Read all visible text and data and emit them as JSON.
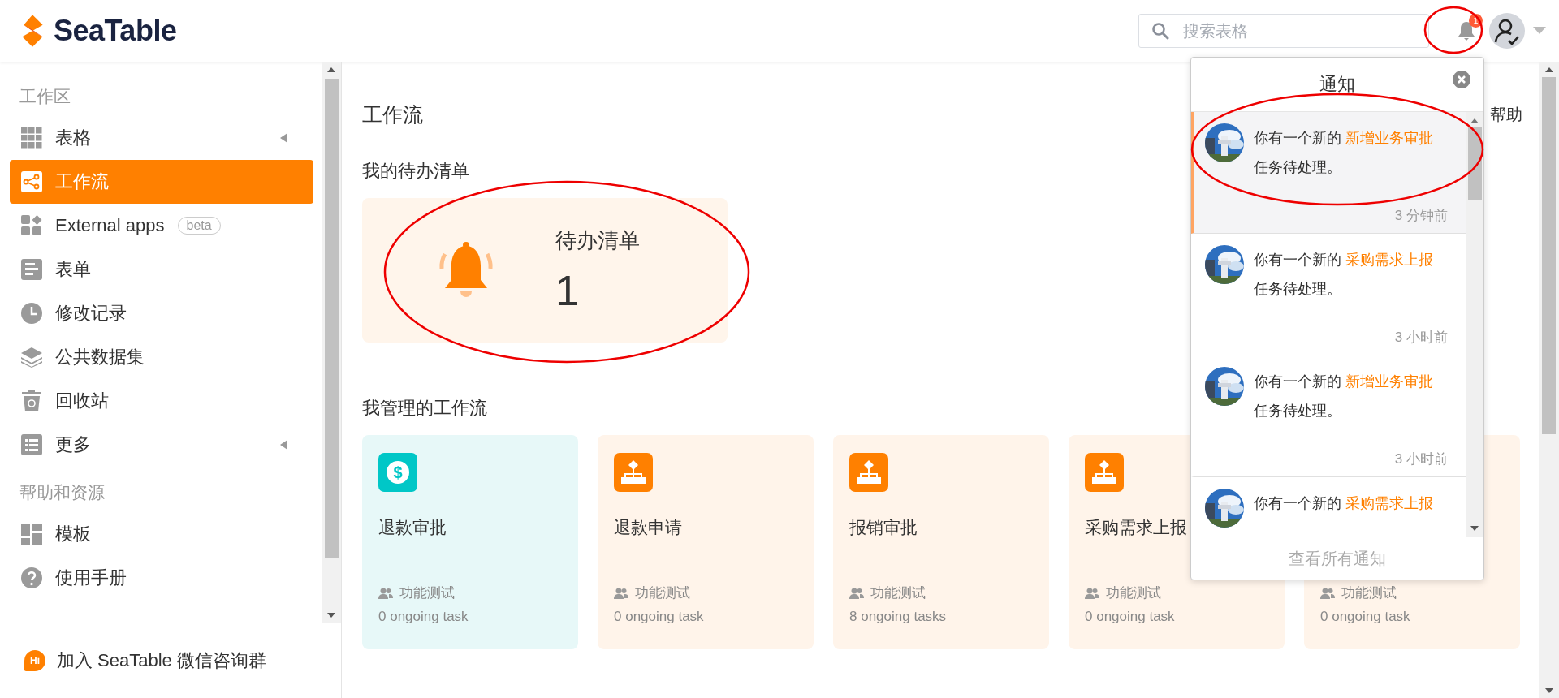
{
  "header": {
    "logo": "SeaTable",
    "search": {
      "placeholder": "搜索表格"
    },
    "notification_badge": "1"
  },
  "sidebar": {
    "sections": [
      {
        "title": "工作区",
        "items": [
          {
            "label": "表格",
            "selected": false,
            "expandable": true
          },
          {
            "label": "工作流",
            "selected": true,
            "expandable": false
          },
          {
            "label": "External apps",
            "selected": false,
            "expandable": false,
            "badge": "beta"
          },
          {
            "label": "表单",
            "selected": false,
            "expandable": false
          },
          {
            "label": "修改记录",
            "selected": false,
            "expandable": false
          },
          {
            "label": "公共数据集",
            "selected": false,
            "expandable": false
          },
          {
            "label": "回收站",
            "selected": false,
            "expandable": false
          },
          {
            "label": "更多",
            "selected": false,
            "expandable": true
          }
        ]
      },
      {
        "title": "帮助和资源",
        "items": [
          {
            "label": "模板",
            "selected": false,
            "expandable": false
          },
          {
            "label": "使用手册",
            "selected": false,
            "expandable": false
          }
        ]
      }
    ],
    "footer": {
      "badge": "Hi",
      "label": "加入 SeaTable 微信咨询群"
    }
  },
  "main": {
    "title": "工作流",
    "help": "帮助",
    "todo_heading": "我的待办清单",
    "todo": {
      "label": "待办清单",
      "count": "1"
    },
    "managed_heading": "我管理的工作流",
    "workflows": [
      {
        "kind": "money",
        "symbol": "$",
        "name": "退款审批",
        "group": "功能测试",
        "tasks": "0 ongoing task"
      },
      {
        "kind": "flow",
        "name": "退款申请",
        "group": "功能测试",
        "tasks": "0 ongoing task"
      },
      {
        "kind": "flow",
        "name": "报销审批",
        "group": "功能测试",
        "tasks": "8 ongoing tasks"
      },
      {
        "kind": "flow",
        "name": "采购需求上报",
        "group": "功能测试",
        "tasks": "0 ongoing task"
      },
      {
        "kind": "flow",
        "group": "功能测试",
        "tasks": "0 ongoing task"
      }
    ]
  },
  "notifications": {
    "title": "通知",
    "items": [
      {
        "prefix": "你有一个新的",
        "link": "新增业务审批",
        "suffix": "任务待处理。",
        "time": "3 分钟前",
        "selected": true
      },
      {
        "prefix": "你有一个新的",
        "link": "采购需求上报",
        "suffix": "任务待处理。",
        "time": "3 小时前",
        "selected": false
      },
      {
        "prefix": "你有一个新的",
        "link": "新增业务审批",
        "suffix": "任务待处理。",
        "time": "3 小时前",
        "selected": false
      },
      {
        "prefix": "你有一个新的",
        "link": "采购需求上报",
        "selected": false
      }
    ],
    "footer": "查看所有通知"
  }
}
